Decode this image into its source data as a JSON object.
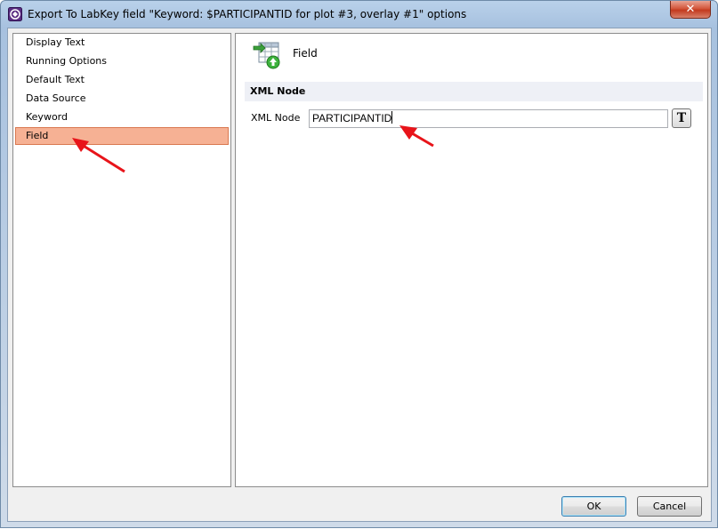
{
  "window": {
    "title": "Export To LabKey field \"Keyword: $PARTICIPANTID for plot #3, overlay #1\" options",
    "close_glyph": "✕"
  },
  "sidebar": {
    "items": [
      {
        "label": "Display Text",
        "selected": false
      },
      {
        "label": "Running Options",
        "selected": false
      },
      {
        "label": "Default Text",
        "selected": false
      },
      {
        "label": "Data Source",
        "selected": false
      },
      {
        "label": "Keyword",
        "selected": false
      },
      {
        "label": "Field",
        "selected": true
      }
    ],
    "selected_color": "#f6b194"
  },
  "content": {
    "page_title": "Field",
    "page_icon": "table-field-add-icon",
    "section_title": "XML Node",
    "xml_node_label": "XML Node",
    "xml_node_value": "PARTICIPANTID",
    "text_button_label": "T"
  },
  "footer": {
    "ok_label": "OK",
    "cancel_label": "Cancel"
  },
  "annotations": {
    "arrow_color": "#e8141a"
  }
}
